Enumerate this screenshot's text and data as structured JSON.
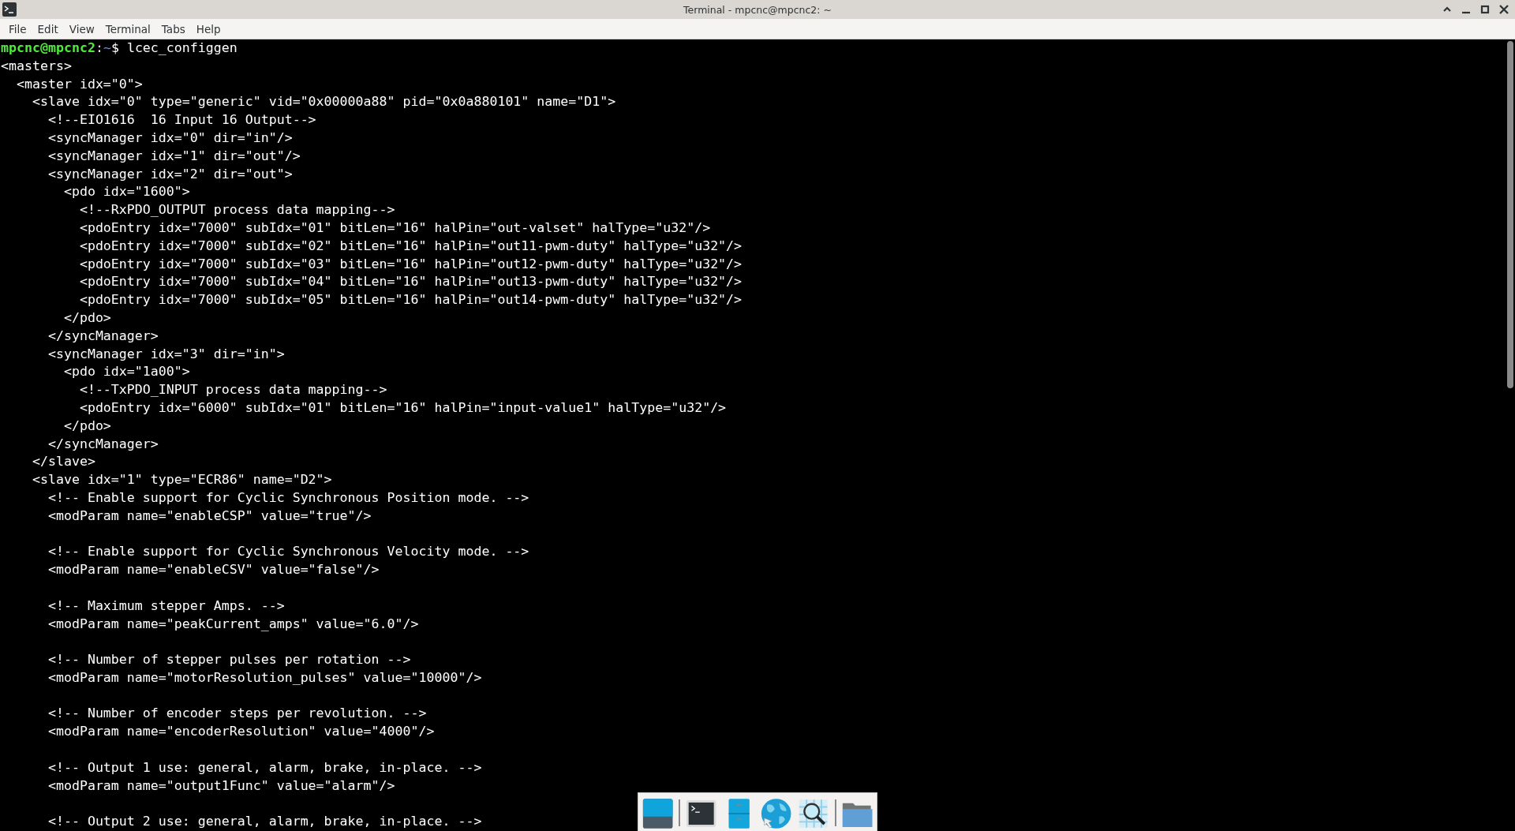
{
  "window": {
    "title": "Terminal - mpcnc@mpcnc2: ~"
  },
  "menu": [
    "File",
    "Edit",
    "View",
    "Terminal",
    "Tabs",
    "Help"
  ],
  "prompt": {
    "user_host": "mpcnc@mpcnc2",
    "separator": ":",
    "path": "~",
    "symbol": "$",
    "command": "lcec_configgen"
  },
  "output_blocks": [
    [
      "<masters>",
      "  <master idx=\"0\">",
      "    <slave idx=\"0\" type=\"generic\" vid=\"0x00000a88\" pid=\"0x0a880101\" name=\"D1\">",
      "      <!--EIO1616  16 Input 16 Output-->",
      "      <syncManager idx=\"0\" dir=\"in\"/>",
      "      <syncManager idx=\"1\" dir=\"out\"/>",
      "      <syncManager idx=\"2\" dir=\"out\">",
      "        <pdo idx=\"1600\">",
      "          <!--RxPDO_OUTPUT process data mapping-->",
      "          <pdoEntry idx=\"7000\" subIdx=\"01\" bitLen=\"16\" halPin=\"out-valset\" halType=\"u32\"/>",
      "          <pdoEntry idx=\"7000\" subIdx=\"02\" bitLen=\"16\" halPin=\"out11-pwm-duty\" halType=\"u32\"/>",
      "          <pdoEntry idx=\"7000\" subIdx=\"03\" bitLen=\"16\" halPin=\"out12-pwm-duty\" halType=\"u32\"/>",
      "          <pdoEntry idx=\"7000\" subIdx=\"04\" bitLen=\"16\" halPin=\"out13-pwm-duty\" halType=\"u32\"/>",
      "          <pdoEntry idx=\"7000\" subIdx=\"05\" bitLen=\"16\" halPin=\"out14-pwm-duty\" halType=\"u32\"/>",
      "        </pdo>",
      "      </syncManager>",
      "      <syncManager idx=\"3\" dir=\"in\">",
      "        <pdo idx=\"1a00\">",
      "          <!--TxPDO_INPUT process data mapping-->",
      "          <pdoEntry idx=\"6000\" subIdx=\"01\" bitLen=\"16\" halPin=\"input-value1\" halType=\"u32\"/>",
      "        </pdo>",
      "      </syncManager>",
      "    </slave>",
      "    <slave idx=\"1\" type=\"ECR86\" name=\"D2\">",
      "      <!-- Enable support for Cyclic Synchronous Position mode. -->",
      "      <modParam name=\"enableCSP\" value=\"true\"/>"
    ],
    [
      "      <!-- Enable support for Cyclic Synchronous Velocity mode. -->",
      "      <modParam name=\"enableCSV\" value=\"false\"/>"
    ],
    [
      "      <!-- Maximum stepper Amps. -->",
      "      <modParam name=\"peakCurrent_amps\" value=\"6.0\"/>"
    ],
    [
      "      <!-- Number of stepper pulses per rotation -->",
      "      <modParam name=\"motorResolution_pulses\" value=\"10000\"/>"
    ],
    [
      "      <!-- Number of encoder steps per revolution. -->",
      "      <modParam name=\"encoderResolution\" value=\"4000\"/>"
    ],
    [
      "      <!-- Output 1 use: general, alarm, brake, in-place. -->",
      "      <modParam name=\"output1Func\" value=\"alarm\"/>"
    ],
    [
      "      <!-- Output 2 use: general, alarm, brake, in-place. -->"
    ]
  ]
}
